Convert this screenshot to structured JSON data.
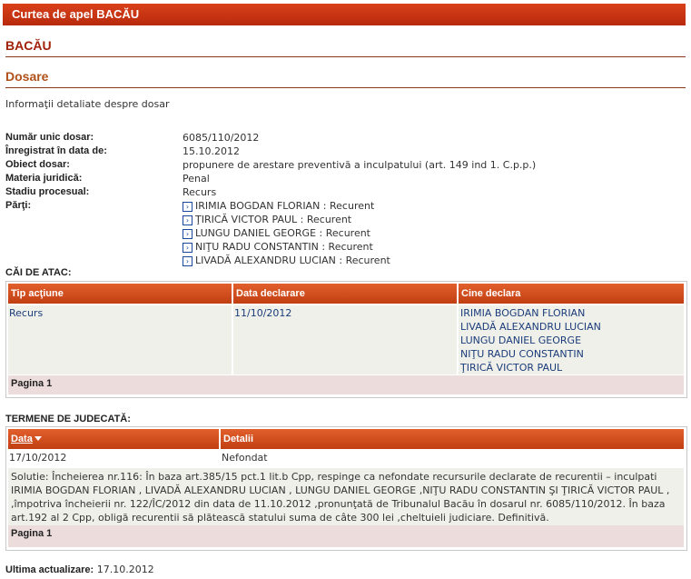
{
  "header": {
    "court": "Curtea de apel BACĂU"
  },
  "institution": "BACĂU",
  "section_title": "Dosare",
  "subtitle": "Informaţii detaliate despre dosar",
  "info": {
    "numar_label": "Număr unic dosar:",
    "numar": "6085/110/2012",
    "inreg_label": "Înregistrat în data de:",
    "inreg": "15.10.2012",
    "obiect_label": "Obiect dosar:",
    "obiect": "propunere de arestare preventivă a inculpatului (art. 149 ind 1. C.p.p.)",
    "materia_label": "Materia juridică:",
    "materia": "Penal",
    "stadiu_label": "Stadiu procesual:",
    "stadiu": "Recurs",
    "parti_label": "Părţi:"
  },
  "parties": [
    "IRIMIA BOGDAN FLORIAN : Recurent",
    "ŢIRICĂ VICTOR PAUL : Recurent",
    "LUNGU DANIEL GEORGE : Recurent",
    "NIŢU RADU CONSTANTIN : Recurent",
    "LIVADĂ ALEXANDRU LUCIAN : Recurent"
  ],
  "appeals": {
    "label": "CĂI DE ATAC:",
    "headers": [
      "Tip acţiune",
      "Data declarare",
      "Cine declara"
    ],
    "tip": "Recurs",
    "data": "11/10/2012",
    "cine": [
      "IRIMIA BOGDAN FLORIAN",
      "LIVADĂ ALEXANDRU LUCIAN",
      "LUNGU DANIEL GEORGE",
      "NIŢU RADU CONSTANTIN",
      "ŢIRICĂ VICTOR PAUL"
    ],
    "pagination": "Pagina 1"
  },
  "hearings": {
    "label": "TERMENE DE JUDECATĂ:",
    "headers": [
      "Data",
      "Detalii"
    ],
    "date": "17/10/2012",
    "details": "Nefondat",
    "solution": [
      "Solutie: Încheierea nr.116: În baza art.385/15 pct.1 lit.b Cpp, respinge ca nefondate recursurile declarate de recurentii – inculpati",
      "IRIMIA BOGDAN FLORIAN , LIVADĂ ALEXANDRU LUCIAN , LUNGU DANIEL GEORGE ,NIŢU RADU CONSTANTIN ŞI ŢIRICĂ VICTOR PAUL ,",
      ",împotriva încheierii nr. 122/ÎC/2012 din data de 11.10.2012 ,pronunţată de Tribunalul Bacău în dosarul nr. 6085/110/2012. În baza",
      "art.192 al 2 Cpp, obligă recurentii să plătească statului suma de câte 300 lei ,cheltuieli judiciare. Definitivă."
    ],
    "pagination": "Pagina 1"
  },
  "footer": {
    "label": "Ultima actualizare:",
    "value": "17.10.2012"
  }
}
